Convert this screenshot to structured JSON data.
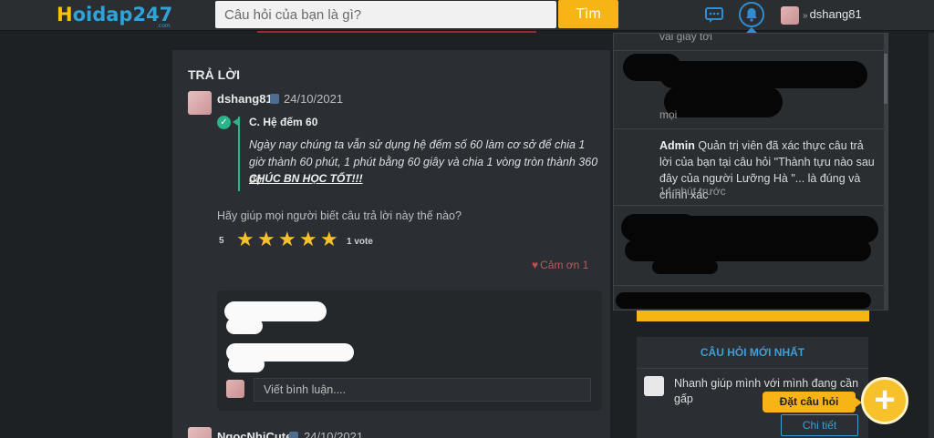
{
  "header": {
    "logo_main": "Hoidap247",
    "logo_first": "H",
    "logo_rest": "oidap247",
    "logo_suffix": ".com",
    "search_placeholder": "Câu hỏi của bạn là gì?",
    "search_button": "Tìm",
    "username": "dshang81",
    "user_chevron": "»"
  },
  "answer_card": {
    "title": "TRẢ LỜI",
    "answer": {
      "username": "dshang81",
      "date": "24/10/2021",
      "heading": "C. Hệ đếm 60",
      "body": "Ngày nay chúng ta vẫn sử dụng hệ đếm số 60 làm cơ sở để chia 1 giờ thành 60 phút, 1 phút bằng 60 giây và chia 1 vòng tròn thành 360 độ.",
      "signature": "CHÚC BN HỌC TỐT!!!",
      "check_glyph": "✓"
    },
    "rating": {
      "prompt": "Hãy giúp mọi người biết câu trả lời này thế nào?",
      "score": "5",
      "stars": 5,
      "star_glyph": "★",
      "votes": "1 vote"
    },
    "thanks": "Cảm ơn 1",
    "heart_glyph": "♥",
    "comment_placeholder": "Viết bình luận....",
    "next_answer": {
      "username": "NgocNhiCute",
      "date": "24/10/2021"
    }
  },
  "notifications": {
    "partial_top": "vài giây tới",
    "partial_mid": "mọi",
    "item_admin": {
      "sender": "Admin",
      "message": "Quản trị viên đã xác thực câu trả lời của bạn tại câu hỏi \"Thành tựu nào sau đây của người Lưỡng Hà \"... là đúng và chính xác",
      "time": "14 phút trước"
    }
  },
  "sidebar": {
    "newest_title": "CÂU HỎI MỚI NHẤT",
    "question_text": "Nhanh giúp mình với mình đang cần gấp",
    "detail_button": "Chi tiết"
  },
  "ask_button": {
    "label": "Đặt câu hỏi",
    "glyph": "+"
  },
  "colors": {
    "accent_yellow": "#f6b415",
    "accent_blue": "#3b9fd6",
    "verified_green": "#2bb38a",
    "background": "#1d2124"
  }
}
